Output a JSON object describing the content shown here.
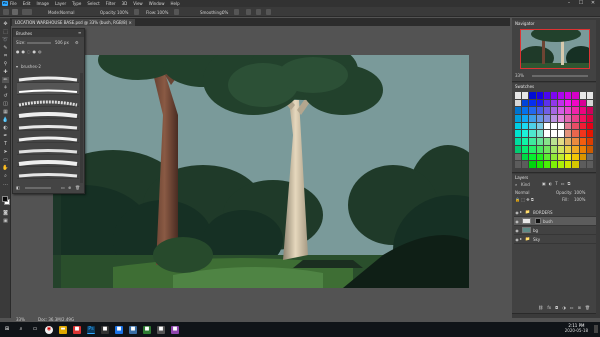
{
  "app": {
    "name": "Photoshop",
    "menu": [
      "File",
      "Edit",
      "Image",
      "Layer",
      "Type",
      "Select",
      "Filter",
      "3D",
      "View",
      "Window",
      "Help"
    ],
    "window_controls": [
      "–",
      "☐",
      "✕"
    ]
  },
  "options_bar": {
    "mode_label": "Mode:",
    "mode_value": "Normal",
    "opacity_label": "Opacity:",
    "opacity_value": "100%",
    "flow_label": "Flow:",
    "flow_value": "100%",
    "smoothing_label": "Smoothing:",
    "smoothing_value": "0%"
  },
  "document": {
    "tab_title": "LOCATION WAREHOUSE BASE.psd @ 33% (bush, RGB/8) ×",
    "zoom": "33%",
    "doc_info": "Doc: 36.3M/2.49G"
  },
  "brushes_panel": {
    "title": "Brushes",
    "size_label": "Size:",
    "size_value": "506 px",
    "group_label": "brushes-2"
  },
  "navigator": {
    "title": "Navigator",
    "zoom": "33%"
  },
  "swatches": {
    "title": "Swatches"
  },
  "layers_panel": {
    "title": "Layers",
    "kind_label": "Kind",
    "blend_mode": "Normal",
    "opacity_label": "Opacity:",
    "opacity_value": "100%",
    "fill_label": "Fill:",
    "fill_value": "100%",
    "layers": [
      {
        "name": "BORDERS",
        "kind": "group"
      },
      {
        "name": "bush",
        "kind": "layer"
      },
      {
        "name": "bg",
        "kind": "layer"
      },
      {
        "name": "Sky",
        "kind": "layer"
      }
    ]
  },
  "taskbar": {
    "time": "2:11 PM",
    "date": "2020-05-18"
  },
  "colors": {
    "ui_bg": "#535353",
    "panel_bg": "#424242",
    "accent": "#31a8ff",
    "sky": "#7a9a9a",
    "foliage_dark": "#1c3324",
    "grass": "#3e6e34"
  }
}
